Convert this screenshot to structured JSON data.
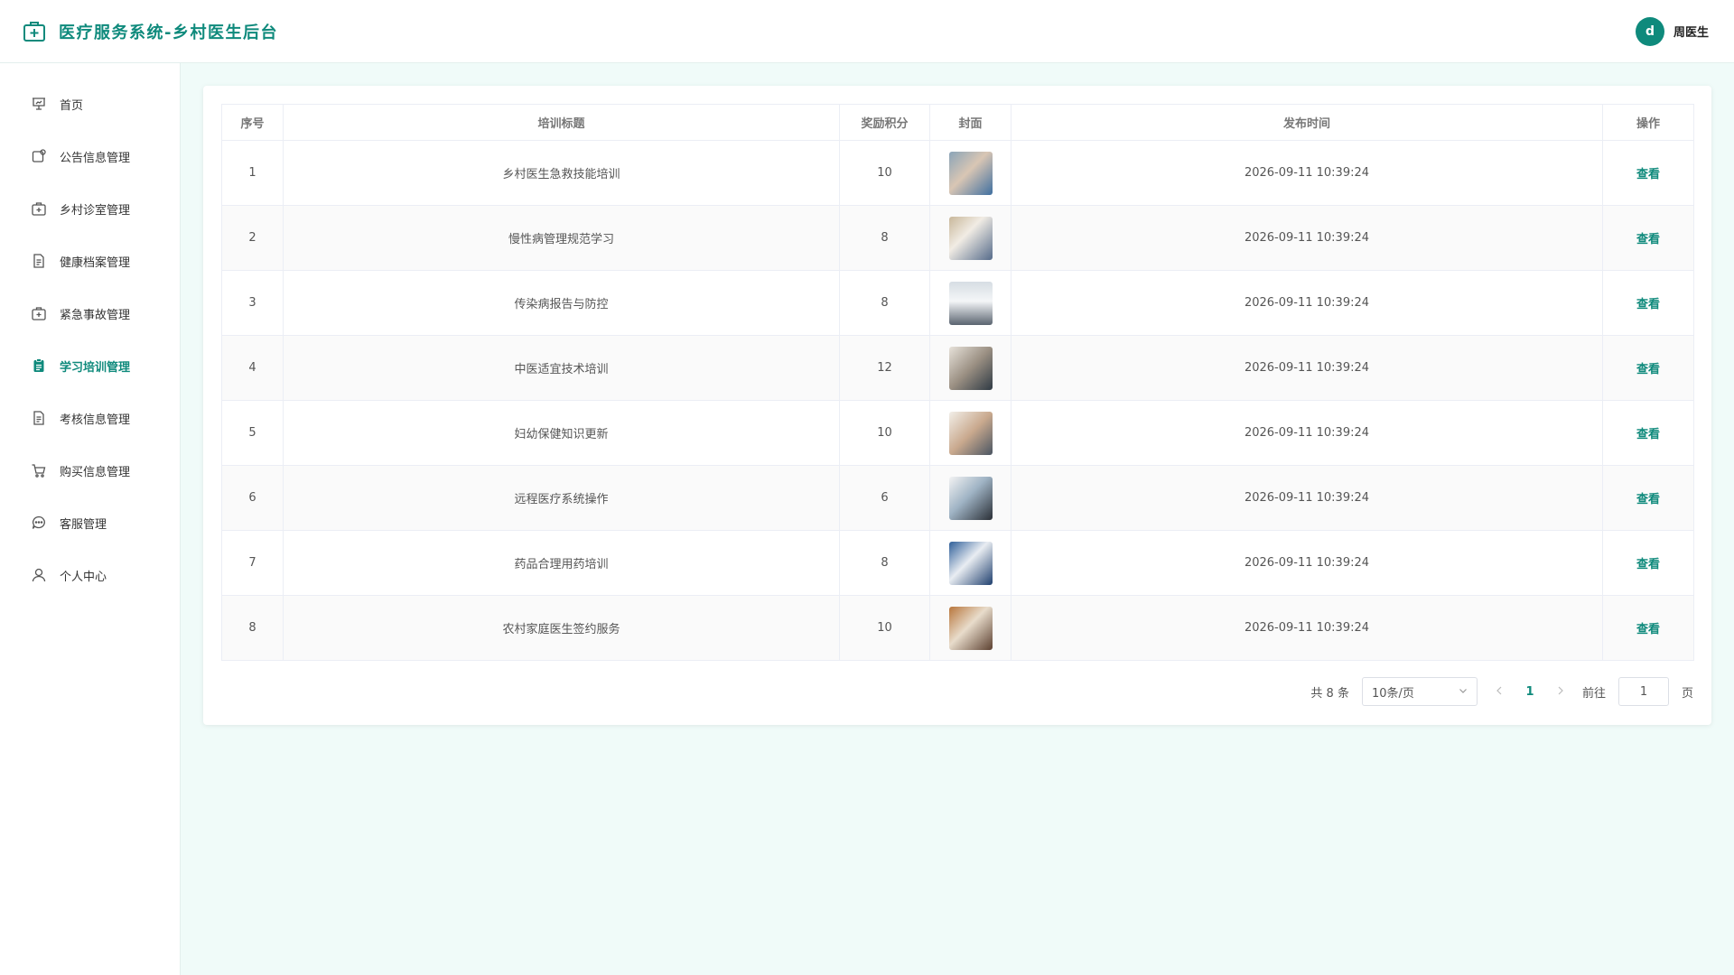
{
  "header": {
    "title": "医疗服务系统-乡村医生后台",
    "avatar_letter": "d",
    "user_name": "周医生"
  },
  "colors": {
    "accent": "#0f8a7c",
    "background": "#f0fbf9"
  },
  "sidebar": {
    "items": [
      {
        "label": "首页",
        "icon": "presentation-icon",
        "active": false
      },
      {
        "label": "公告信息管理",
        "icon": "notice-icon",
        "active": false
      },
      {
        "label": "乡村诊室管理",
        "icon": "medical-kit-icon",
        "active": false
      },
      {
        "label": "健康档案管理",
        "icon": "document-icon",
        "active": false
      },
      {
        "label": "紧急事故管理",
        "icon": "emergency-kit-icon",
        "active": false
      },
      {
        "label": "学习培训管理",
        "icon": "clipboard-icon",
        "active": true
      },
      {
        "label": "考核信息管理",
        "icon": "document-icon",
        "active": false
      },
      {
        "label": "购买信息管理",
        "icon": "cart-icon",
        "active": false
      },
      {
        "label": "客服管理",
        "icon": "chat-icon",
        "active": false
      },
      {
        "label": "个人中心",
        "icon": "user-icon",
        "active": false
      }
    ]
  },
  "table": {
    "headers": [
      "序号",
      "培训标题",
      "奖励积分",
      "封面",
      "发布时间",
      "操作"
    ],
    "rows": [
      {
        "index": "1",
        "title": "乡村医生急救技能培训",
        "points": "10",
        "time": "2026-09-11 10:39:24",
        "action": "查看"
      },
      {
        "index": "2",
        "title": "慢性病管理规范学习",
        "points": "8",
        "time": "2026-09-11 10:39:24",
        "action": "查看"
      },
      {
        "index": "3",
        "title": "传染病报告与防控",
        "points": "8",
        "time": "2026-09-11 10:39:24",
        "action": "查看"
      },
      {
        "index": "4",
        "title": "中医适宜技术培训",
        "points": "12",
        "time": "2026-09-11 10:39:24",
        "action": "查看"
      },
      {
        "index": "5",
        "title": "妇幼保健知识更新",
        "points": "10",
        "time": "2026-09-11 10:39:24",
        "action": "查看"
      },
      {
        "index": "6",
        "title": "远程医疗系统操作",
        "points": "6",
        "time": "2026-09-11 10:39:24",
        "action": "查看"
      },
      {
        "index": "7",
        "title": "药品合理用药培训",
        "points": "8",
        "time": "2026-09-11 10:39:24",
        "action": "查看"
      },
      {
        "index": "8",
        "title": "农村家庭医生签约服务",
        "points": "10",
        "time": "2026-09-11 10:39:24",
        "action": "查看"
      }
    ]
  },
  "pagination": {
    "total": "共 8 条",
    "page_size": "10条/页",
    "current_page": "1",
    "goto_label": "前往",
    "goto_value": "1",
    "page_suffix": "页"
  }
}
